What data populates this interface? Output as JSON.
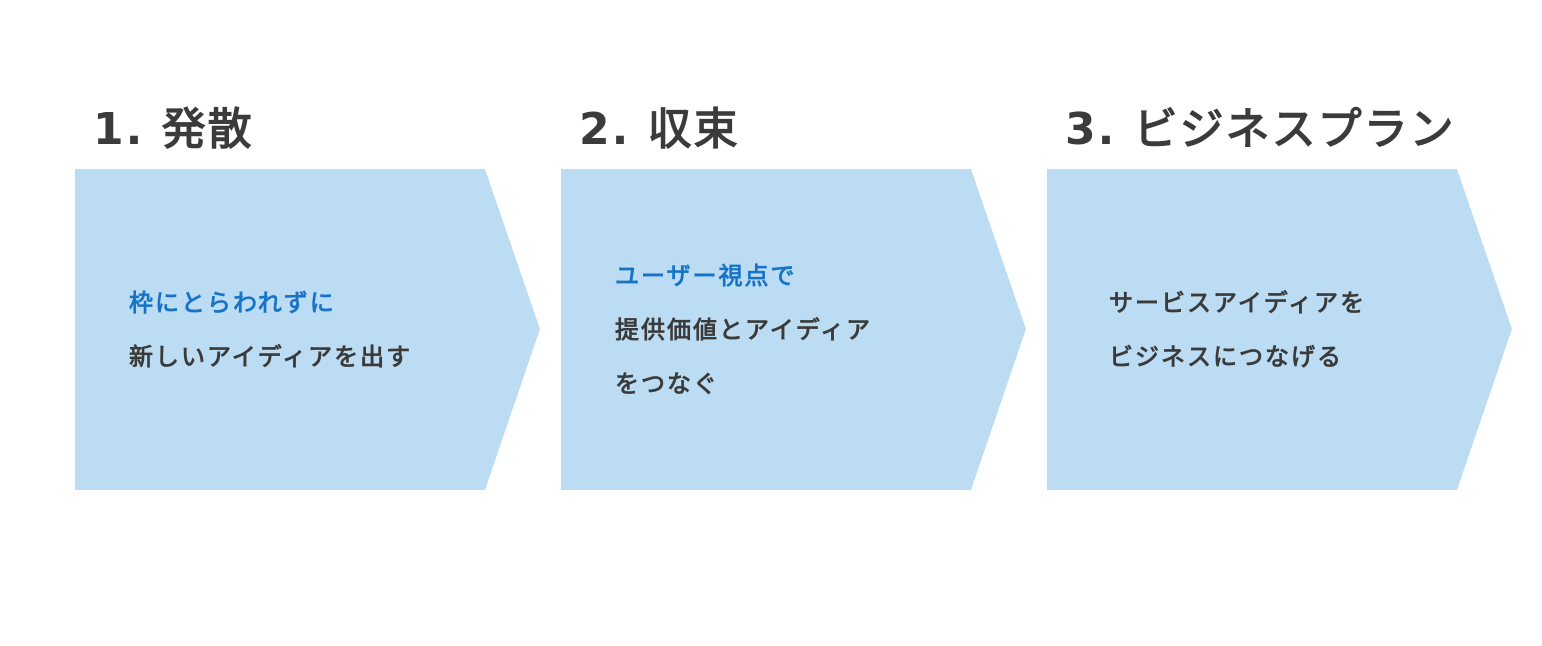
{
  "colors": {
    "arrow_fill": "#bbdcf2",
    "title_text": "#3b3b3b",
    "body_text": "#3a3a3a",
    "accent_text": "#1673c8"
  },
  "steps": [
    {
      "title": "1. 発散",
      "highlight": "枠にとらわれずに",
      "lines": [
        "新しいアイディアを出す"
      ]
    },
    {
      "title": "2. 収束",
      "highlight": "ユーザー視点で",
      "lines": [
        "提供価値とアイディア",
        "をつなぐ"
      ]
    },
    {
      "title": "3. ビジネスプラン",
      "highlight": "",
      "lines": [
        "サービスアイディアを",
        "ビジネスにつなげる"
      ]
    }
  ]
}
